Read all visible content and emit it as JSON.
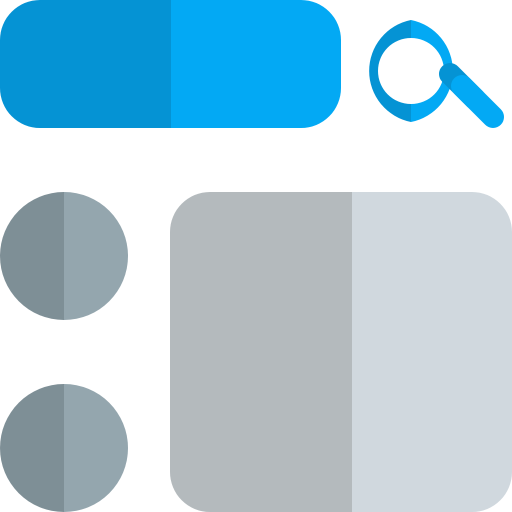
{
  "icon": {
    "name": "search-results-layout-icon",
    "colors": {
      "search_bar_dark": "#0593d4",
      "search_bar_light": "#03a9f4",
      "magnifier_dark": "#0593d4",
      "magnifier_light": "#03a9f4",
      "bullet_dark": "#7e8f96",
      "bullet_light": "#94a6ae",
      "panel_dark": "#b4babd",
      "panel_light": "#d0d8de"
    },
    "parts": [
      "search-bar",
      "magnifier-icon",
      "list-bullet",
      "list-bullet",
      "content-panel"
    ]
  }
}
